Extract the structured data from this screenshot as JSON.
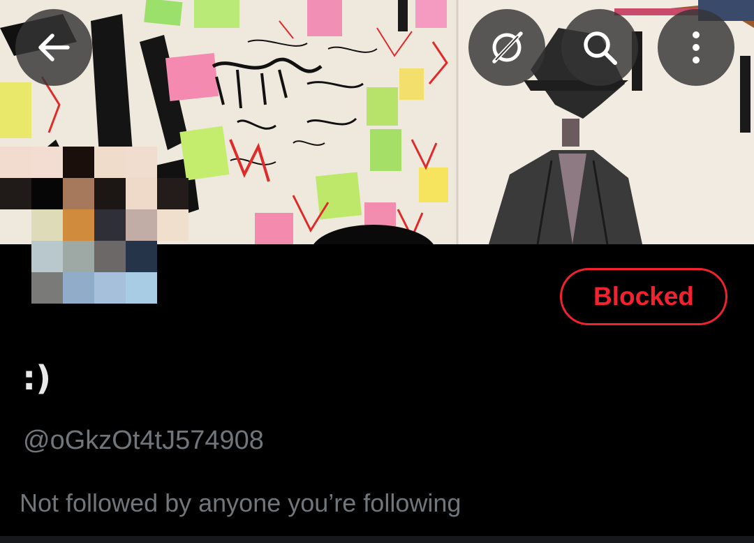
{
  "header": {
    "back_icon": "arrow-left-icon",
    "grok_icon": "grok-icon",
    "search_icon": "search-icon",
    "more_icon": "more-vertical-icon"
  },
  "profile": {
    "display_name": ":)",
    "handle": "@oGkzOt4tJ574908",
    "blocked_label": "Blocked",
    "followers_note": "Not followed by anyone you’re following"
  },
  "colors": {
    "background": "#000000",
    "blocked_red": "#f4212e",
    "secondary_text": "#71767b",
    "primary_text": "#e7e9ea"
  }
}
